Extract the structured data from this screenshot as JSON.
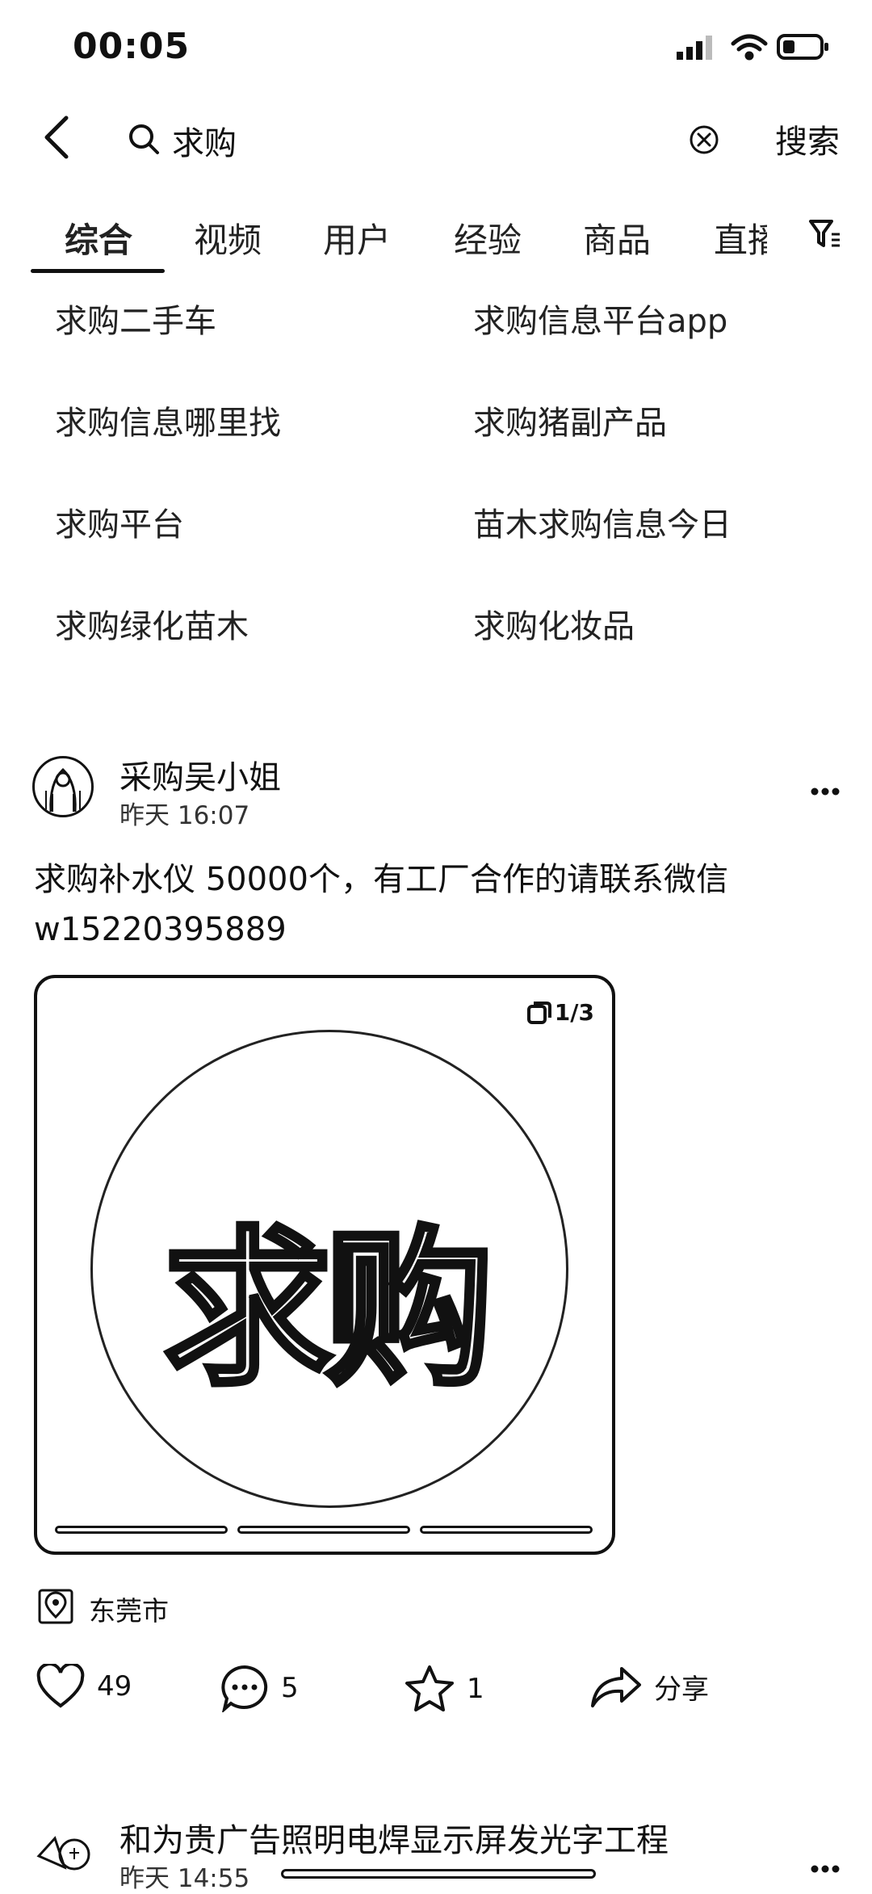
{
  "status_bar": {
    "time": "00:05"
  },
  "search": {
    "query": "求购",
    "submit_label": "搜索"
  },
  "tabs": [
    {
      "label": "综合",
      "active": true
    },
    {
      "label": "视频"
    },
    {
      "label": "用户"
    },
    {
      "label": "经验"
    },
    {
      "label": "商品"
    },
    {
      "label": "直播"
    }
  ],
  "suggestions": [
    "求购二手车",
    "求购信息平台app",
    "求购信息哪里找",
    "求购猪副产品",
    "求购平台",
    "苗木求购信息今日",
    "求购绿化苗木",
    "求购化妆品"
  ],
  "posts": [
    {
      "author": "采购吴小姐",
      "time": "昨天 16:07",
      "text": "求购补水仪 50000个，有工厂合作的请联系微信w15220395889",
      "image": {
        "word": "求购",
        "counter": "1/3",
        "pages": 3,
        "active_page": 1
      },
      "location": "东莞市",
      "likes": "49",
      "comments": "5",
      "favorites": "1",
      "share_label": "分享"
    },
    {
      "author": "和为贵广告照明电焊显示屏发光字工程",
      "time": "昨天 14:55"
    }
  ]
}
